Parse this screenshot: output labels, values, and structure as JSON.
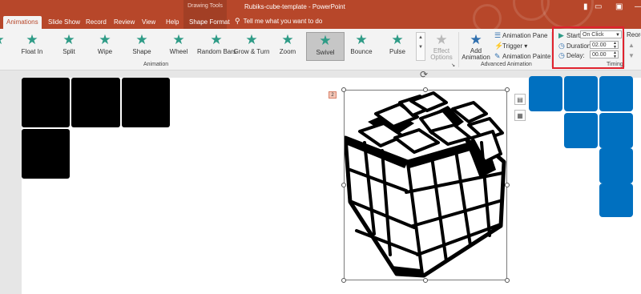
{
  "window": {
    "title": "Rubiks-cube-template  -  PowerPoint",
    "context_group": "Drawing Tools",
    "tell_me": "Tell me what you want to do"
  },
  "tabs": [
    {
      "label": "Animations",
      "active": true
    },
    {
      "label": "Slide Show"
    },
    {
      "label": "Record"
    },
    {
      "label": "Review"
    },
    {
      "label": "View"
    },
    {
      "label": "Help"
    },
    {
      "label": "Shape Format"
    }
  ],
  "ribbon": {
    "animation_gallery": [
      {
        "label": "Float In"
      },
      {
        "label": "Split"
      },
      {
        "label": "Wipe"
      },
      {
        "label": "Shape"
      },
      {
        "label": "Wheel"
      },
      {
        "label": "Random Bars"
      },
      {
        "label": "Grow & Turn"
      },
      {
        "label": "Zoom"
      },
      {
        "label": "Swivel",
        "selected": true
      },
      {
        "label": "Bounce"
      },
      {
        "label": "Pulse"
      }
    ],
    "effect_options": "Effect Options",
    "animation_group_label": "Animation",
    "add_animation": "Add Animation",
    "animation_pane": "Animation Pane",
    "trigger": "Trigger",
    "animation_painter": "Animation Painter",
    "advanced_group_label": "Advanced Animation",
    "timing": {
      "start_label": "Start:",
      "start_value": "On Click",
      "duration_label": "Duration:",
      "duration_value": "02.00",
      "delay_label": "Delay:",
      "delay_value": "00.00",
      "group_label": "Timing"
    },
    "reorder_label": "Reord"
  },
  "slide": {
    "animation_marker": "2"
  },
  "colors": {
    "accent": "#b7472a",
    "blue_tile": "#0070c0",
    "black_tile": "#000000",
    "highlight": "#e0232e"
  }
}
